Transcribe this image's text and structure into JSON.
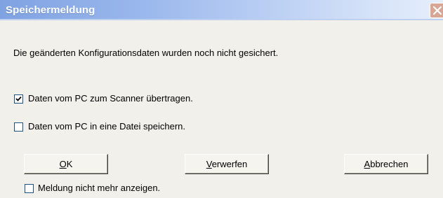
{
  "window": {
    "title": "Speichermeldung"
  },
  "message": "Die geänderten Konfigurationsdaten wurden noch nicht gesichert.",
  "options": [
    {
      "label": "Daten vom PC zum Scanner übertragen.",
      "checked": true
    },
    {
      "label": "Daten vom PC in eine Datei speichern.",
      "checked": false
    }
  ],
  "buttons": {
    "ok": {
      "mnemonic": "O",
      "rest": "K"
    },
    "discard": {
      "mnemonic": "V",
      "rest": "erwerfen"
    },
    "cancel": {
      "mnemonic": "A",
      "rest": "bbrechen"
    }
  },
  "dont_show": {
    "label": "Meldung nicht mehr anzeigen.",
    "checked": false
  },
  "colors": {
    "titlebar_start": "#7fa2e1",
    "titlebar_end": "#e6eefb",
    "close_button": "#d9a594",
    "dialog_bg": "#f1f0ea",
    "checkbox_border": "#1c5180"
  }
}
